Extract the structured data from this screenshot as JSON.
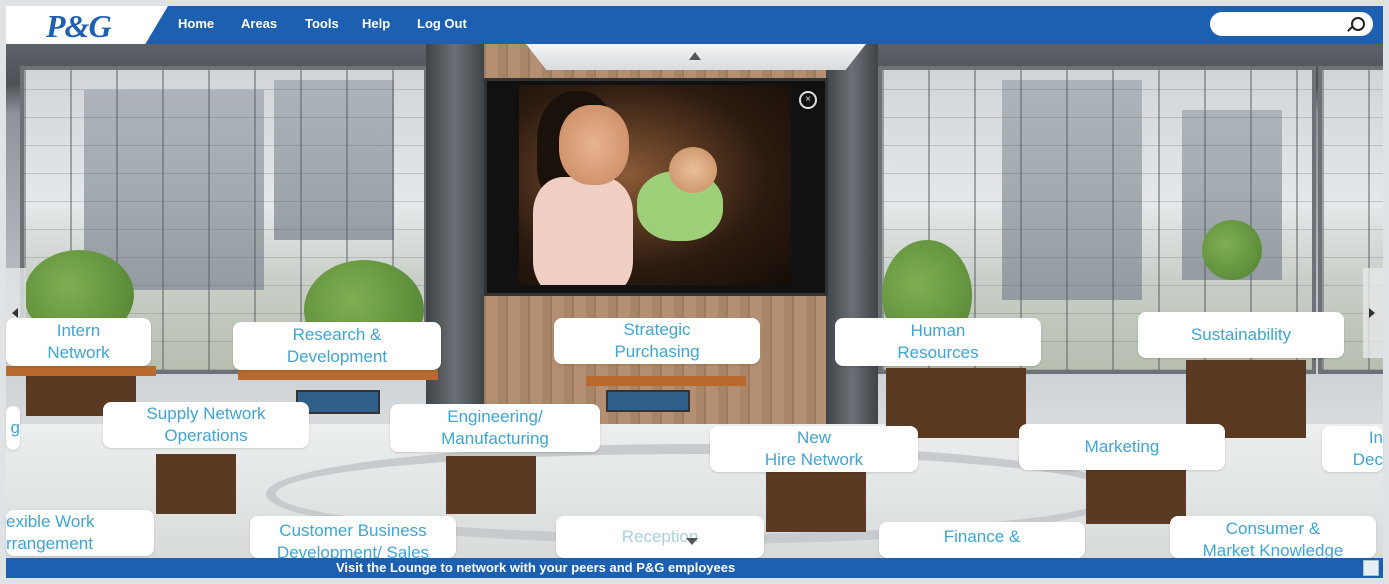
{
  "header": {
    "logo": "P&G",
    "nav": [
      "Home",
      "Areas",
      "Tools",
      "Help",
      "Log Out"
    ],
    "search": {
      "placeholder": "",
      "icon": "search-icon"
    }
  },
  "video": {
    "close_icon": "close-icon"
  },
  "areas": {
    "intern_network": "Intern\nNetwork",
    "research_development": "Research &\nDevelopment",
    "strategic_purchasing": "Strategic\nPurchasing",
    "human_resources": "Human\nResources",
    "sustainability": "Sustainability",
    "partial_left": "g",
    "supply_network": "Supply Network\nOperations",
    "engineering": "Engineering/\nManufacturing",
    "new_hire": "New\nHire Network",
    "marketing": "Marketing",
    "partial_right": "In\nDec",
    "flexible_work": "exible Work\nrrangement",
    "customer_business": "Customer Business\nDevelopment/ Sales",
    "reception": "Reception",
    "finance": "Finance &",
    "consumer_market": "Consumer &\nMarket Knowledge"
  },
  "footer": {
    "message": "Visit the Lounge to network with your peers and P&G employees"
  },
  "colors": {
    "brand_blue": "#1d5fb0",
    "label_text": "#3ea5d6"
  }
}
